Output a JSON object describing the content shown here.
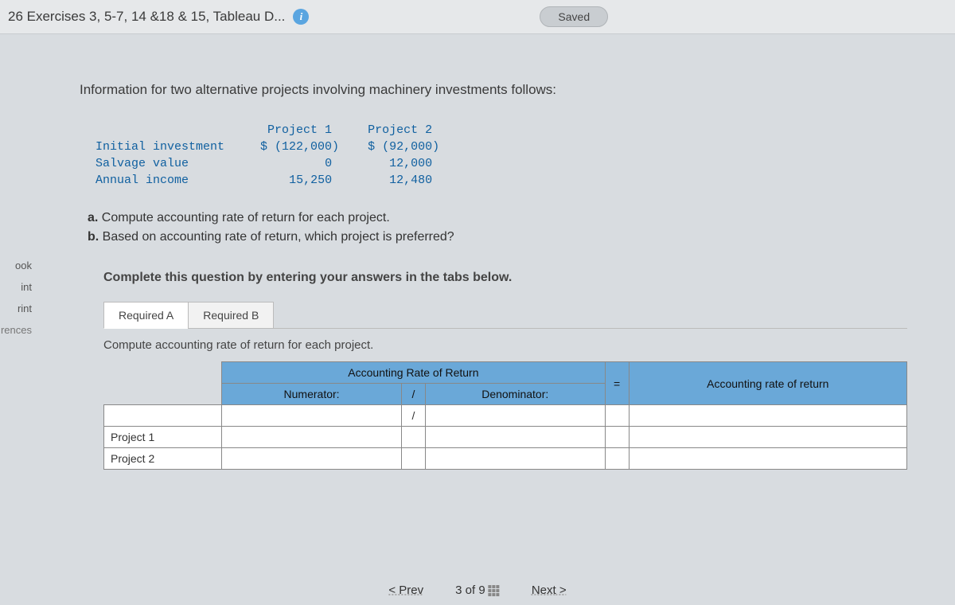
{
  "topbar": {
    "title": "26 Exercises 3, 5-7, 14 &18 & 15, Tableau D...",
    "saved": "Saved"
  },
  "sidebar": {
    "items": [
      "ook",
      "int",
      "rint",
      "rences"
    ]
  },
  "intro": "Information for two alternative projects involving machinery investments follows:",
  "data_table": {
    "col1": "Project 1",
    "col2": "Project 2",
    "rows": [
      {
        "label": "Initial investment",
        "p1": "$ (122,000)",
        "p2": "$ (92,000)"
      },
      {
        "label": "Salvage value",
        "p1": "0",
        "p2": "12,000"
      },
      {
        "label": "Annual income",
        "p1": "15,250",
        "p2": "12,480"
      }
    ]
  },
  "questions": {
    "a": "a.",
    "a_text": " Compute accounting rate of return for each project.",
    "b": "b.",
    "b_text": " Based on accounting rate of return, which project is preferred?"
  },
  "instruction": "Complete this question by entering your answers in the tabs below.",
  "tabs": {
    "a": "Required A",
    "b": "Required B"
  },
  "panel": {
    "title": "Compute accounting rate of return for each project.",
    "group_header": "Accounting Rate of Return",
    "num": "Numerator:",
    "slash": "/",
    "den": "Denominator:",
    "eq": "=",
    "result": "Accounting rate of return",
    "row1": "Project 1",
    "row2": "Project 2"
  },
  "footer": {
    "prev": "Prev",
    "pos": "3 of 9",
    "next": "Next"
  },
  "chart_data": {
    "type": "table",
    "title": "Project investment data",
    "columns": [
      "",
      "Project 1",
      "Project 2"
    ],
    "rows": [
      [
        "Initial investment",
        -122000,
        -92000
      ],
      [
        "Salvage value",
        0,
        12000
      ],
      [
        "Annual income",
        15250,
        12480
      ]
    ]
  }
}
